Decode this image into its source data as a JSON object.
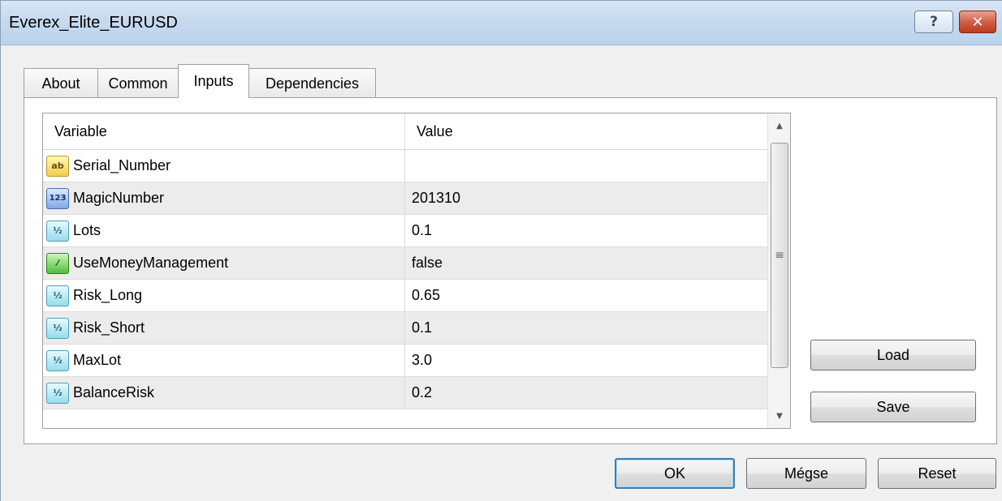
{
  "window": {
    "title": "Everex_Elite_EURUSD",
    "help_symbol": "?",
    "close_symbol": "✕"
  },
  "tabs": [
    {
      "label": "About"
    },
    {
      "label": "Common"
    },
    {
      "label": "Inputs"
    },
    {
      "label": "Dependencies"
    }
  ],
  "active_tab": "Inputs",
  "grid": {
    "header": {
      "variable": "Variable",
      "value": "Value"
    },
    "rows": [
      {
        "type": "string",
        "icon": "ab",
        "variable": "Serial_Number",
        "value": ""
      },
      {
        "type": "int",
        "icon": "123",
        "variable": "MagicNumber",
        "value": "201310"
      },
      {
        "type": "double",
        "icon": "½",
        "variable": "Lots",
        "value": "0.1"
      },
      {
        "type": "bool",
        "icon": "⁄",
        "variable": "UseMoneyManagement",
        "value": "false"
      },
      {
        "type": "double",
        "icon": "½",
        "variable": "Risk_Long",
        "value": "0.65"
      },
      {
        "type": "double",
        "icon": "½",
        "variable": "Risk_Short",
        "value": "0.1"
      },
      {
        "type": "double",
        "icon": "½",
        "variable": "MaxLot",
        "value": "3.0"
      },
      {
        "type": "double",
        "icon": "½",
        "variable": "BalanceRisk",
        "value": "0.2"
      }
    ],
    "scroll": {
      "up": "▲",
      "down": "▼",
      "grip": "≡"
    }
  },
  "side_buttons": {
    "load": "Load",
    "save": "Save"
  },
  "footer_buttons": {
    "ok": "OK",
    "cancel": "Mégse",
    "reset": "Reset"
  }
}
